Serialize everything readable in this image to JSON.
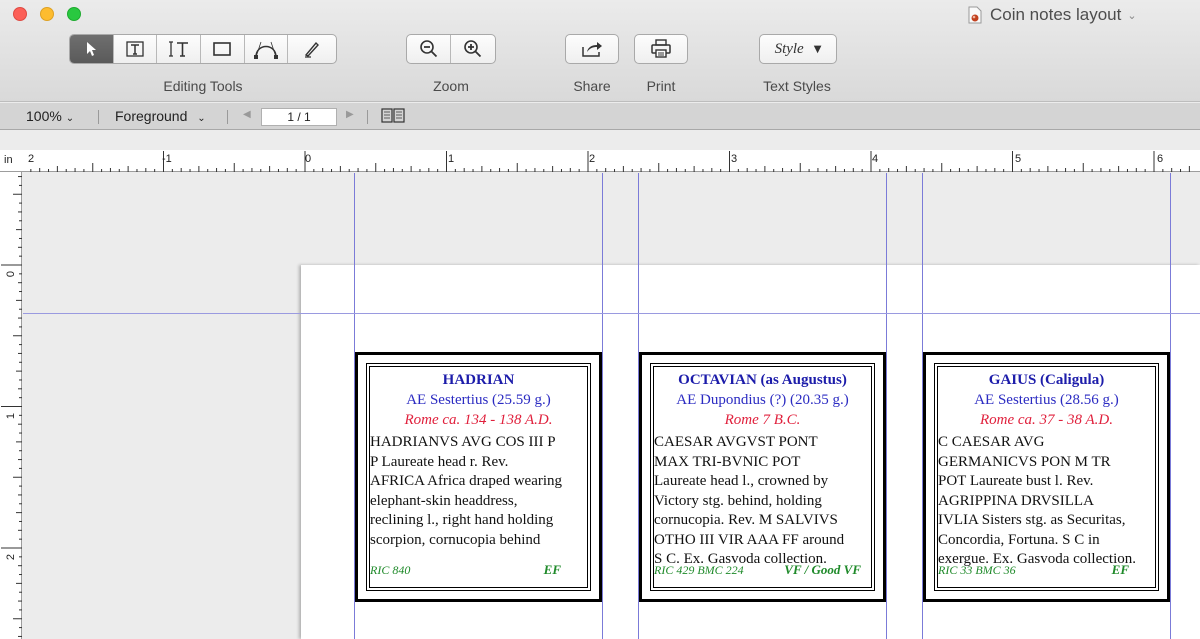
{
  "window": {
    "title": "Coin notes layout"
  },
  "toolbar": {
    "groups": {
      "editing": "Editing Tools",
      "zoom": "Zoom",
      "share": "Share",
      "print": "Print",
      "text_styles": "Text Styles"
    },
    "style_button": "Style",
    "icons": [
      "arrow-pointer-icon",
      "text-box-icon",
      "vertical-text-icon",
      "rectangle-icon",
      "bezier-curve-icon",
      "pen-icon",
      "zoom-out-icon",
      "zoom-in-icon",
      "share-icon",
      "printer-icon"
    ]
  },
  "subbar": {
    "zoom_level": "100%",
    "layer": "Foreground",
    "page": "1 / 1"
  },
  "ruler": {
    "unit": "in",
    "h_labels": [
      "2",
      "-1",
      "0",
      "1",
      "2",
      "3",
      "4",
      "5",
      "6"
    ],
    "v_labels": [
      "0",
      "1",
      "2"
    ]
  },
  "cards": [
    {
      "title": "HADRIAN",
      "denomination": "AE Sestertius (25.59 g.)",
      "mint": "Rome ca. 134 - 138 A.D.",
      "lines": [
        "HADRIANVS AVG COS III P",
        "P Laureate head r.  Rev.",
        "AFRICA Africa draped wearing",
        "elephant-skin headdress,",
        "reclining l., right hand holding",
        "scorpion, cornucopia behind"
      ],
      "reference": "RIC 840",
      "grade": "EF"
    },
    {
      "title": "OCTAVIAN (as Augustus)",
      "denomination": "AE Dupondius (?) (20.35 g.)",
      "mint": "Rome 7 B.C.",
      "lines": [
        "CAESAR AVGVST PONT",
        "MAX TRI-BVNIC POT",
        "Laureate head l., crowned by",
        "Victory stg. behind, holding",
        "cornucopia.  Rev. M SALVIVS",
        "OTHO III VIR AAA FF around",
        "S C. Ex. Gasvoda collection."
      ],
      "reference": "RIC 429  BMC 224",
      "grade": "VF / Good VF"
    },
    {
      "title": "GAIUS (Caligula)",
      "denomination": "AE Sestertius (28.56 g.)",
      "mint": "Rome ca. 37 - 38 A.D.",
      "lines": [
        "C CAESAR AVG",
        "GERMANICVS PON M TR",
        "POT Laureate bust l. Rev.",
        "AGRIPPINA DRVSILLA",
        "IVLIA Sisters stg. as Securitas,",
        "Concordia, Fortuna. S C in",
        "exergue. Ex. Gasvoda collection."
      ],
      "reference": "RIC 33   BMC 36",
      "grade": "EF"
    }
  ]
}
